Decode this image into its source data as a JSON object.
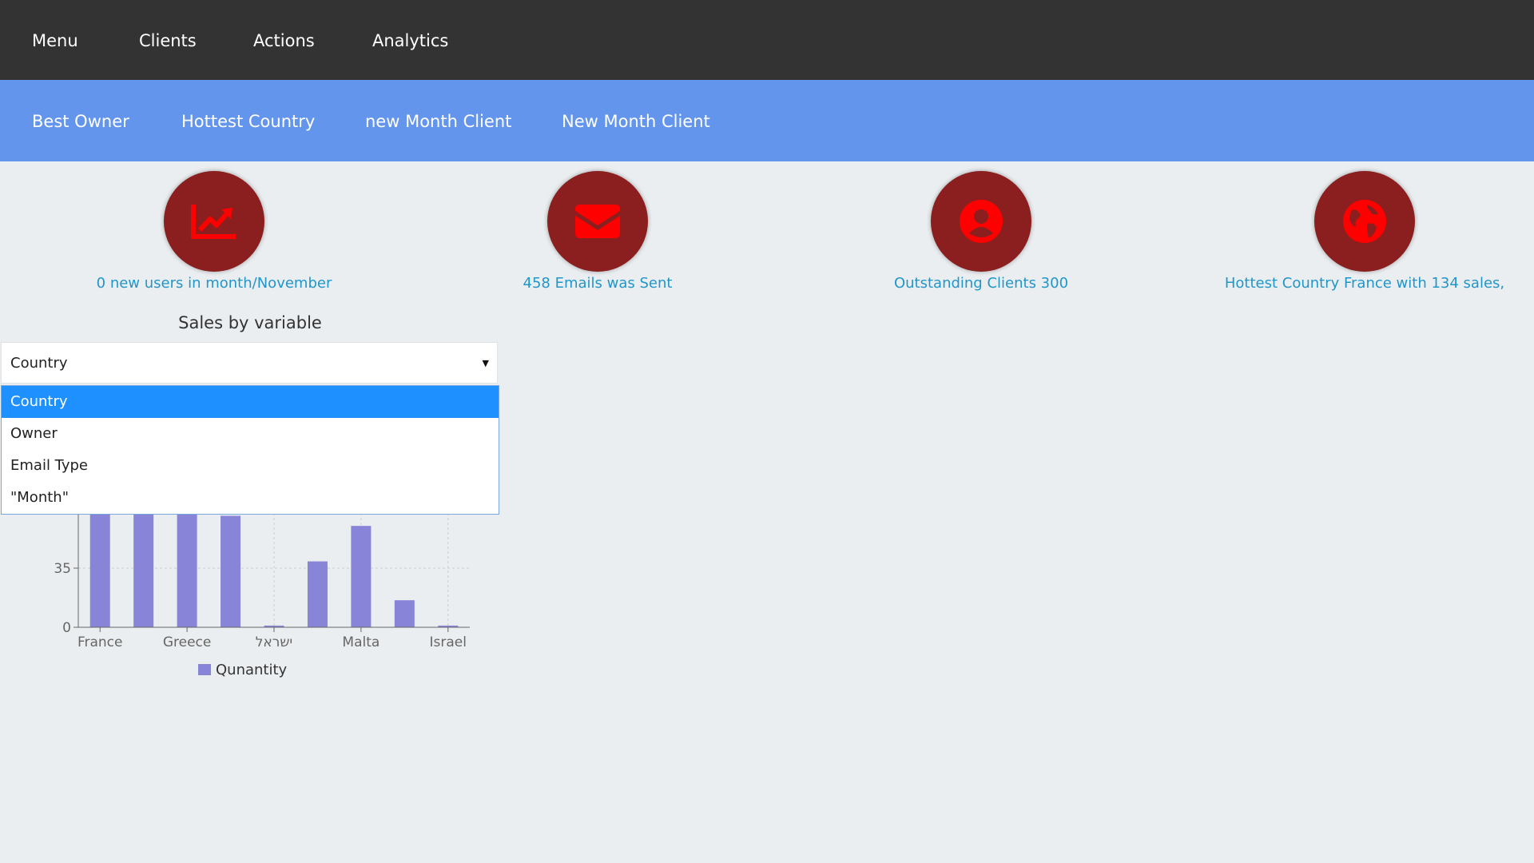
{
  "topnav": {
    "items": [
      {
        "label": "Menu"
      },
      {
        "label": "Clients"
      },
      {
        "label": "Actions"
      },
      {
        "label": "Analytics"
      }
    ]
  },
  "subnav": {
    "items": [
      {
        "label": "Best Owner"
      },
      {
        "label": "Hottest Country"
      },
      {
        "label": "new Month Client"
      },
      {
        "label": "New Month Client"
      }
    ]
  },
  "stats": [
    {
      "icon": "trending-up-chart-icon",
      "label": "0 new users in month/November"
    },
    {
      "icon": "envelope-icon",
      "label": "458 Emails was Sent"
    },
    {
      "icon": "user-circle-icon",
      "label": "Outstanding Clients 300"
    },
    {
      "icon": "globe-icon",
      "label": "Hottest Country France with 134 sales,"
    }
  ],
  "colors": {
    "topnav_bg": "#333333",
    "subnav_bg": "#6495ed",
    "circle_bg": "#8b1e1e",
    "icon": "#ff0000",
    "stat_text": "#2196c9",
    "bar": "#8884d8",
    "selected_option": "#1e90ff"
  },
  "sales": {
    "title": "Sales by variable",
    "select_value": "Country",
    "options": [
      {
        "label": "Country",
        "selected": true
      },
      {
        "label": "Owner",
        "selected": false
      },
      {
        "label": "Email Type",
        "selected": false
      },
      {
        "label": "\"Month\"",
        "selected": false
      }
    ]
  },
  "chart_data": {
    "type": "bar",
    "categories": [
      "France",
      "",
      "Greece",
      "",
      "ישראל",
      "",
      "Malta",
      "",
      "Israel"
    ],
    "tick_labels_shown": [
      "France",
      "Greece",
      "ישראל",
      "Malta",
      "Israel"
    ],
    "series": [
      {
        "name": "Qunantity",
        "values": [
          134,
          95,
          90,
          66,
          1,
          39,
          60,
          16,
          1
        ]
      }
    ],
    "y_ticks": [
      0,
      35
    ],
    "ylim": [
      0,
      140
    ],
    "grid": true,
    "legend": "bottom"
  }
}
